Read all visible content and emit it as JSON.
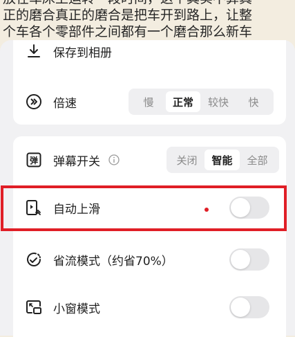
{
  "background_text": {
    "lines": [
      "放在车床上运转一段时间，这个其实不算真",
      "正的磨合真正的磨合是把车开到路上，让整",
      "个车各个零部件之间都有一个磨合那么新车"
    ]
  },
  "settings": {
    "save_to_album_label": "保存到相册",
    "speed": {
      "label": "倍速",
      "options": [
        "慢",
        "正常",
        "较快",
        "快"
      ],
      "selected": "正常"
    },
    "danmaku": {
      "label": "弹幕开关",
      "options": [
        "关闭",
        "智能",
        "全部"
      ],
      "selected": "智能"
    },
    "auto_scroll": {
      "label": "自动上滑",
      "enabled": false
    },
    "data_saver": {
      "label": "省流模式（约省70%）",
      "enabled": false
    },
    "mini_window": {
      "label": "小窗模式",
      "enabled": false
    }
  },
  "colors": {
    "highlight": "#e01e26",
    "toggle_off": "#e6e6e8",
    "segment_bg": "#efeff1"
  },
  "icons": [
    "download-icon",
    "speed-play-icon",
    "danmaku-icon",
    "info-icon",
    "auto-scroll-icon",
    "data-saver-icon",
    "mini-window-icon"
  ]
}
